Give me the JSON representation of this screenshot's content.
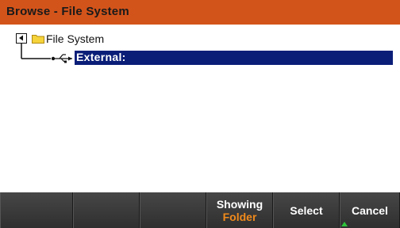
{
  "window": {
    "title": "Browse - File System"
  },
  "tree": {
    "root_label": "File System",
    "child_label": "External:",
    "root_expand_icon": "collapse-toggle-icon",
    "root_icon": "folder-icon",
    "child_icon": "usb-icon"
  },
  "softkeys": {
    "key4_line1": "Showing",
    "key4_line2": "Folder",
    "key5": "Select",
    "key6": "Cancel"
  },
  "colors": {
    "title_bar": "#d3541a",
    "selection": "#0a1e78",
    "softkey_sub": "#f08a1c",
    "arrow": "#2ec13a"
  }
}
